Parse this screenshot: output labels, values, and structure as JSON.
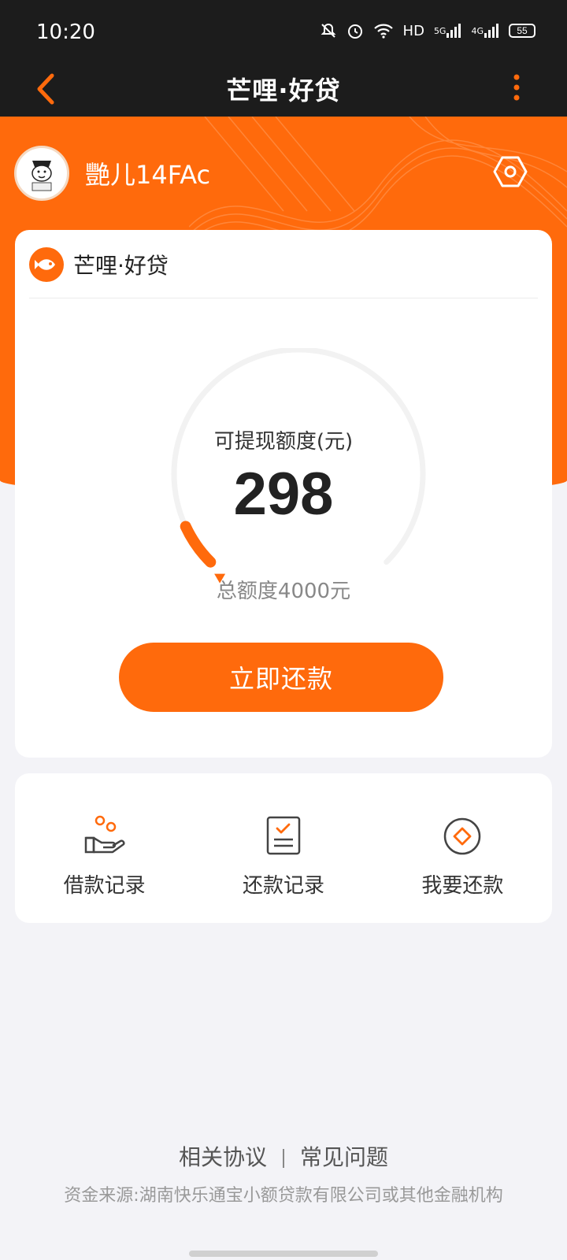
{
  "status_bar": {
    "time": "10:20",
    "network_label": "HD",
    "signal1": "5G",
    "signal2": "4G",
    "battery": "55"
  },
  "nav": {
    "title": "芒哩·好贷"
  },
  "user": {
    "name": "艷儿14FAc"
  },
  "card": {
    "brand": "芒哩·好贷",
    "gauge_label": "可提现额度(元)",
    "available": "298",
    "total": "总额度4000元",
    "available_fraction": 0.0745,
    "repay_button": "立即还款"
  },
  "shortcuts": [
    {
      "label": "借款记录",
      "icon": "coins-hand-icon"
    },
    {
      "label": "还款记录",
      "icon": "checklist-icon"
    },
    {
      "label": "我要还款",
      "icon": "diamond-circle-icon"
    }
  ],
  "footer": {
    "link1": "相关协议",
    "link2": "常见问题",
    "note": "资金来源:湖南快乐通宝小额贷款有限公司或其他金融机构"
  },
  "colors": {
    "accent": "#ff6a0c",
    "dark_bar": "#1c1c1c",
    "background": "#f3f3f7"
  }
}
